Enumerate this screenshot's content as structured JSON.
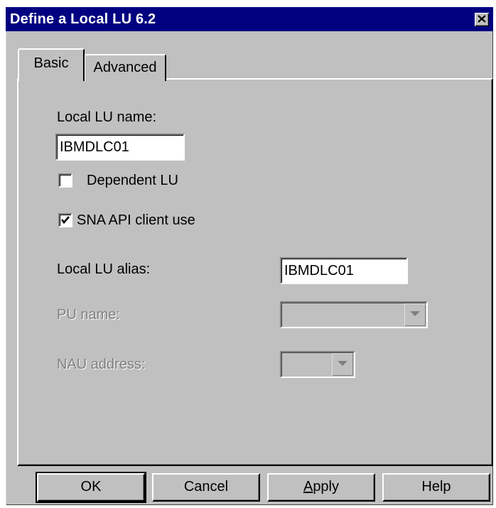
{
  "window": {
    "title": "Define a Local LU 6.2",
    "close_icon": "close-icon"
  },
  "tabs": [
    {
      "label": "Basic",
      "selected": true
    },
    {
      "label": "Advanced",
      "selected": false
    }
  ],
  "basic": {
    "local_lu_name_label": "Local LU name:",
    "local_lu_name_value": "IBMDLC01",
    "dependent_lu_label": "Dependent LU",
    "dependent_lu_checked": false,
    "sna_api_label": "SNA API client use",
    "sna_api_checked": true,
    "local_lu_alias_label": "Local LU alias:",
    "local_lu_alias_value": "IBMDLC01",
    "pu_name_label": "PU name:",
    "pu_name_value": "",
    "nau_address_label": "NAU address:",
    "nau_address_value": ""
  },
  "buttons": {
    "ok": "OK",
    "cancel": "Cancel",
    "apply_mnemonic": "A",
    "apply_rest": "pply",
    "help": "Help"
  },
  "colors": {
    "titlebar": "#000080",
    "dialog": "#c0c0c0",
    "disabled_text": "#808080"
  }
}
